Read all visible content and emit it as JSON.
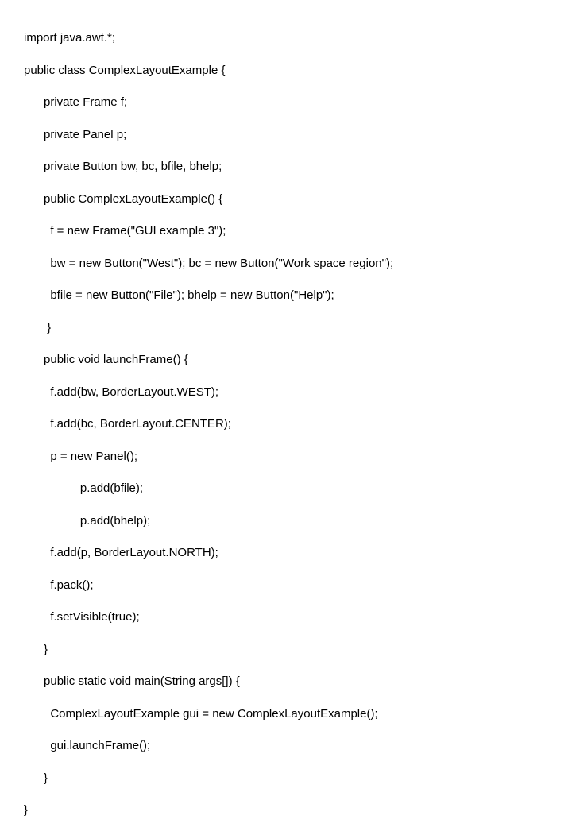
{
  "code": {
    "lines": [
      "import java.awt.*;",
      "public class ComplexLayoutExample {",
      "      private Frame f;",
      "      private Panel p;",
      "      private Button bw, bc, bfile, bhelp;",
      "      public ComplexLayoutExample() {",
      "        f = new Frame(\"GUI example 3\");",
      "        bw = new Button(\"West\"); bc = new Button(\"Work space region\");",
      "        bfile = new Button(\"File\"); bhelp = new Button(\"Help\");",
      "       }",
      "      public void launchFrame() {",
      "        f.add(bw, BorderLayout.WEST);",
      "        f.add(bc, BorderLayout.CENTER);",
      "        p = new Panel();",
      "                 p.add(bfile);",
      "                 p.add(bhelp);",
      "        f.add(p, BorderLayout.NORTH);",
      "        f.pack();",
      "        f.setVisible(true);",
      "      }",
      "      public static void main(String args[]) {",
      "        ComplexLayoutExample gui = new ComplexLayoutExample();",
      "        gui.launchFrame();",
      "      }",
      "}"
    ]
  }
}
